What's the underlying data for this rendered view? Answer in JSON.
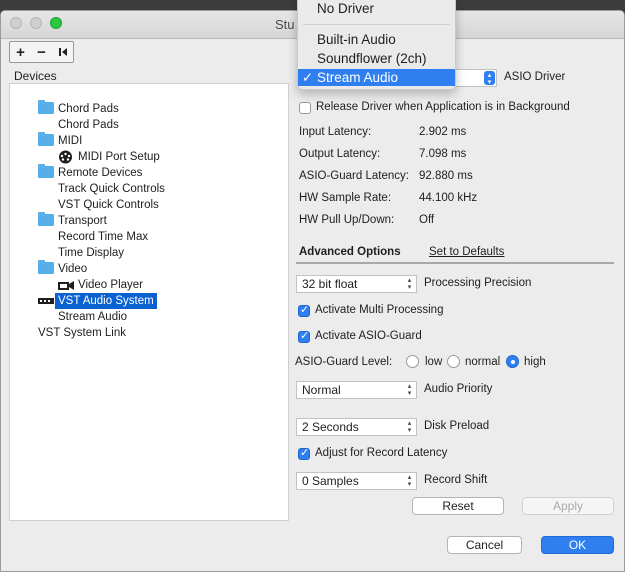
{
  "window": {
    "title": "Stu"
  },
  "toolbar": {
    "add": "+",
    "remove": "−",
    "reset": "⏮"
  },
  "devices": {
    "label": "Devices",
    "items": [
      {
        "label": "Chord Pads",
        "icon": "folder-icon",
        "level": 1
      },
      {
        "label": "Chord Pads",
        "icon": "",
        "level": 2
      },
      {
        "label": "MIDI",
        "icon": "folder-icon",
        "level": 1
      },
      {
        "label": "MIDI Port Setup",
        "icon": "midi-icon",
        "level": 2
      },
      {
        "label": "Remote Devices",
        "icon": "folder-icon",
        "level": 1
      },
      {
        "label": "Track Quick Controls",
        "icon": "",
        "level": 2
      },
      {
        "label": "VST Quick Controls",
        "icon": "",
        "level": 2
      },
      {
        "label": "Transport",
        "icon": "folder-icon",
        "level": 1
      },
      {
        "label": "Record Time Max",
        "icon": "",
        "level": 2
      },
      {
        "label": "Time Display",
        "icon": "",
        "level": 2
      },
      {
        "label": "Video",
        "icon": "folder-icon",
        "level": 1
      },
      {
        "label": "Video Player",
        "icon": "video-icon",
        "level": 2
      },
      {
        "label": "VST Audio System",
        "icon": "audio-icon",
        "level": 1,
        "selected": true
      },
      {
        "label": "Stream Audio",
        "icon": "",
        "level": 2
      },
      {
        "label": "VST System Link",
        "icon": "",
        "level": 0
      }
    ]
  },
  "driver_menu": {
    "items": [
      "No Driver",
      "Built-in Audio",
      "Soundflower (2ch)",
      "Stream Audio"
    ],
    "selected": "Stream Audio",
    "check": "✓"
  },
  "asio": {
    "driver_label": "ASIO Driver",
    "release_label": "Release Driver when Application is in Background",
    "release_checked": false,
    "stats": [
      {
        "label": "Input Latency:",
        "value": "2.902 ms"
      },
      {
        "label": "Output Latency:",
        "value": "7.098 ms"
      },
      {
        "label": "ASIO-Guard Latency:",
        "value": "92.880 ms"
      },
      {
        "label": "HW Sample Rate:",
        "value": "44.100 kHz"
      },
      {
        "label": "HW Pull Up/Down:",
        "value": "Off"
      }
    ]
  },
  "advanced": {
    "tab_label": "Advanced Options",
    "defaults_link": "Set to Defaults",
    "precision_value": "32 bit float",
    "precision_label": "Processing Precision",
    "multi_processing_label": "Activate Multi Processing",
    "multi_processing_checked": true,
    "asio_guard_label": "Activate ASIO-Guard",
    "asio_guard_checked": true,
    "guard_level_label": "ASIO-Guard Level:",
    "guard_levels": [
      "low",
      "normal",
      "high"
    ],
    "guard_level_selected": "high",
    "priority_value": "Normal",
    "priority_label": "Audio Priority",
    "preload_value": "2 Seconds",
    "preload_label": "Disk Preload",
    "record_latency_label": "Adjust for Record Latency",
    "record_latency_checked": true,
    "record_shift_value": "0 Samples",
    "record_shift_label": "Record Shift",
    "reset_label": "Reset",
    "apply_label": "Apply"
  },
  "footer": {
    "cancel_label": "Cancel",
    "ok_label": "OK"
  }
}
